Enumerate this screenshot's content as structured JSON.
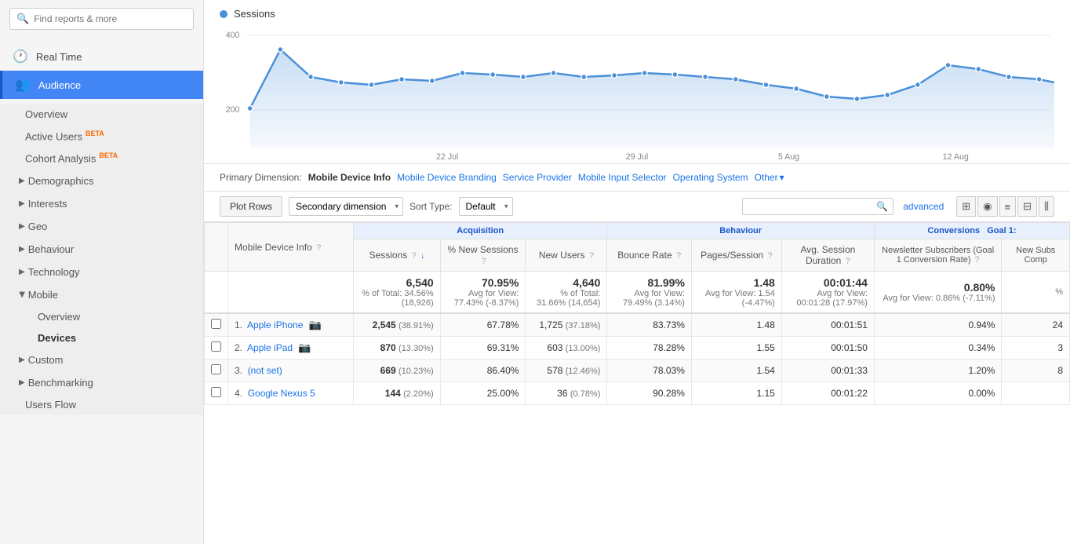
{
  "sidebar": {
    "search_placeholder": "Find reports & more",
    "items": [
      {
        "id": "realtime",
        "label": "Real Time",
        "icon": "🕐",
        "active": false
      },
      {
        "id": "audience",
        "label": "Audience",
        "icon": "👥",
        "active": true
      }
    ],
    "audience_sub": [
      {
        "id": "overview",
        "label": "Overview",
        "active": false
      },
      {
        "id": "active-users",
        "label": "Active Users",
        "beta": true,
        "active": false
      },
      {
        "id": "cohort",
        "label": "Cohort Analysis",
        "beta": true,
        "active": false
      }
    ],
    "expandable": [
      {
        "id": "demographics",
        "label": "Demographics",
        "open": false
      },
      {
        "id": "interests",
        "label": "Interests",
        "open": false
      },
      {
        "id": "geo",
        "label": "Geo",
        "open": false
      },
      {
        "id": "behaviour",
        "label": "Behaviour",
        "open": false
      },
      {
        "id": "technology",
        "label": "Technology",
        "open": false
      },
      {
        "id": "mobile",
        "label": "Mobile",
        "open": true
      }
    ],
    "mobile_sub": [
      {
        "id": "mob-overview",
        "label": "Overview",
        "active": false
      },
      {
        "id": "devices",
        "label": "Devices",
        "active": true
      }
    ],
    "bottom_items": [
      {
        "id": "custom",
        "label": "▶ Custom"
      },
      {
        "id": "benchmarking",
        "label": "▶ Benchmarking"
      },
      {
        "id": "users-flow",
        "label": "Users Flow"
      }
    ]
  },
  "chart": {
    "title": "Sessions",
    "y_labels": [
      "400",
      "200"
    ],
    "x_labels": [
      "22 Jul",
      "29 Jul",
      "5 Aug",
      "12 Aug"
    ]
  },
  "primary_dimension": {
    "label": "Primary Dimension:",
    "active": "Mobile Device Info",
    "links": [
      "Mobile Device Branding",
      "Service Provider",
      "Mobile Input Selector",
      "Operating System",
      "Other"
    ]
  },
  "controls": {
    "plot_rows": "Plot Rows",
    "secondary_dimension": "Secondary dimension",
    "sort_type_label": "Sort Type:",
    "sort_type": "Default",
    "advanced": "advanced"
  },
  "view_icons": [
    "⊞",
    "◉",
    "≡",
    "⊟",
    "⫼"
  ],
  "table": {
    "group_headers": [
      "Acquisition",
      "Behaviour",
      "Conversions",
      "Goal 1:"
    ],
    "columns": [
      {
        "id": "device",
        "label": "Mobile Device Info",
        "has_help": true
      },
      {
        "id": "sessions",
        "label": "Sessions",
        "has_help": true,
        "sort": true
      },
      {
        "id": "pct_new",
        "label": "% New Sessions",
        "has_help": true
      },
      {
        "id": "new_users",
        "label": "New Users",
        "has_help": true
      },
      {
        "id": "bounce",
        "label": "Bounce Rate",
        "has_help": true
      },
      {
        "id": "pages_session",
        "label": "Pages/Session",
        "has_help": true
      },
      {
        "id": "avg_duration",
        "label": "Avg. Session Duration",
        "has_help": true
      },
      {
        "id": "newsletter",
        "label": "Newsletter Subscribers (Goal 1 Conversion Rate)",
        "has_help": true
      },
      {
        "id": "new_subs",
        "label": "New Subs Comp"
      }
    ],
    "totals": {
      "sessions": "6,540",
      "sessions_sub": "% of Total: 34.56% (18,926)",
      "pct_new": "70.95%",
      "pct_new_sub": "Avg for View: 77.43% (-8.37%)",
      "new_users": "4,640",
      "new_users_sub": "% of Total: 31.66% (14,654)",
      "bounce": "81.99%",
      "bounce_sub": "Avg for View: 79.49% (3.14%)",
      "pages_session": "1.48",
      "pages_session_sub": "Avg for View: 1.54 (-4.47%)",
      "avg_duration": "00:01:44",
      "avg_duration_sub": "Avg for View: 00:01:28 (17.97%)",
      "newsletter": "0.80%",
      "newsletter_sub": "Avg for View: 0.86% (-7.11%)",
      "new_subs": "%"
    },
    "rows": [
      {
        "num": "1.",
        "device": "Apple iPhone",
        "has_camera": true,
        "sessions": "2,545",
        "sessions_pct": "(38.91%)",
        "pct_new": "67.78%",
        "new_users": "1,725",
        "new_users_pct": "(37.18%)",
        "bounce": "83.73%",
        "pages_session": "1.48",
        "avg_duration": "00:01:51",
        "newsletter": "0.94%",
        "new_subs": "24"
      },
      {
        "num": "2.",
        "device": "Apple iPad",
        "has_camera": true,
        "sessions": "870",
        "sessions_pct": "(13.30%)",
        "pct_new": "69.31%",
        "new_users": "603",
        "new_users_pct": "(13.00%)",
        "bounce": "78.28%",
        "pages_session": "1.55",
        "avg_duration": "00:01:50",
        "newsletter": "0.34%",
        "new_subs": "3"
      },
      {
        "num": "3.",
        "device": "(not set)",
        "has_camera": false,
        "sessions": "669",
        "sessions_pct": "(10.23%)",
        "pct_new": "86.40%",
        "new_users": "578",
        "new_users_pct": "(12.46%)",
        "bounce": "78.03%",
        "pages_session": "1.54",
        "avg_duration": "00:01:33",
        "newsletter": "1.20%",
        "new_subs": "8"
      },
      {
        "num": "4.",
        "device": "Google Nexus 5",
        "has_camera": false,
        "sessions": "144",
        "sessions_pct": "(2.20%)",
        "pct_new": "25.00%",
        "new_users": "36",
        "new_users_pct": "(0.78%)",
        "bounce": "90.28%",
        "pages_session": "1.15",
        "avg_duration": "00:01:22",
        "newsletter": "0.00%",
        "new_subs": ""
      }
    ]
  }
}
